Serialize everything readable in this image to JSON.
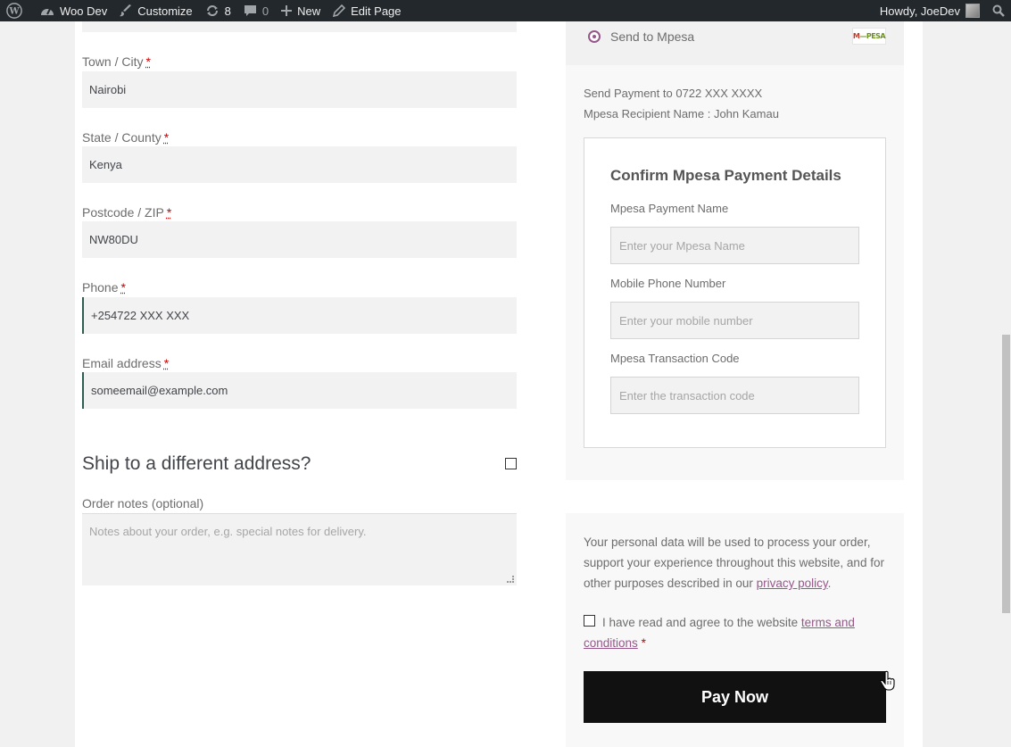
{
  "admin_bar": {
    "site_name": "Woo Dev",
    "customize": "Customize",
    "updates_count": "8",
    "comments_count": "0",
    "new": "New",
    "edit_page": "Edit Page",
    "howdy": "Howdy, JoeDev"
  },
  "billing": {
    "town_label": "Town / City",
    "town_value": "Nairobi",
    "state_label": "State / County",
    "state_value": "Kenya",
    "postcode_label": "Postcode / ZIP",
    "postcode_value": "NW80DU",
    "phone_label": "Phone",
    "phone_value": "+254722 XXX XXX",
    "email_label": "Email address",
    "email_value": "someemail@example.com",
    "required_mark": "*"
  },
  "shipping": {
    "ship_title": "Ship to a different address?",
    "notes_label": "Order notes (optional)",
    "notes_placeholder": "Notes about your order, e.g. special notes for delivery."
  },
  "payment": {
    "method_label": "Send to Mpesa",
    "logo_text_left": "M",
    "logo_text_right": "PESA",
    "send_to": "Send Payment to 0722 XXX XXXX",
    "recipient": "Mpesa Recipient Name : John Kamau",
    "confirm_title": "Confirm Mpesa Payment Details",
    "name_label": "Mpesa Payment Name",
    "name_placeholder": "Enter your Mpesa Name",
    "phone_label": "Mobile Phone Number",
    "phone_placeholder": "Enter your mobile number",
    "code_label": "Mpesa Transaction Code",
    "code_placeholder": "Enter the transaction code"
  },
  "privacy": {
    "text_before": "Your personal data will be used to process your order, support your experience throughout this website, and for other purposes described in our ",
    "link": "privacy policy",
    "text_after": ".",
    "terms_before": "I have read and agree to the website ",
    "terms_link": "terms and conditions",
    "terms_req": "*"
  },
  "pay_button": "Pay Now",
  "colors": {
    "accent": "#96588a",
    "admin_bar": "#23282d",
    "button": "#111111",
    "focus_border": "#2c5e52"
  }
}
